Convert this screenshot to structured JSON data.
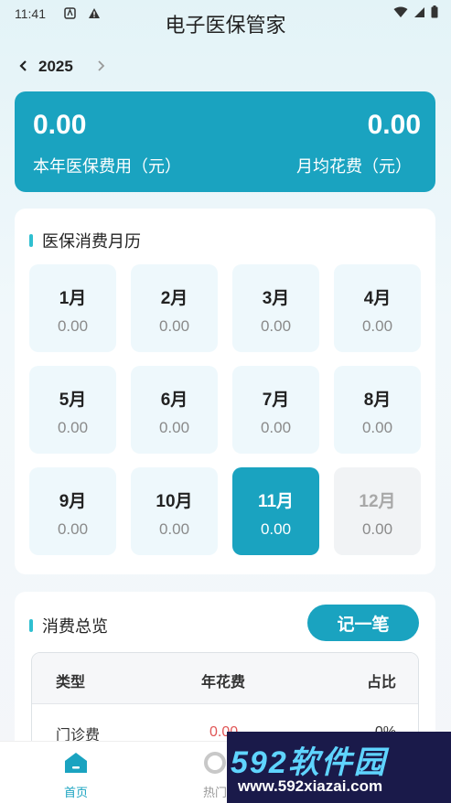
{
  "status": {
    "time": "11:41"
  },
  "header": {
    "title": "电子医保管家"
  },
  "year_nav": {
    "year": "2025",
    "prev": "‹",
    "next": "›"
  },
  "summary": {
    "annual_value": "0.00",
    "annual_label": "本年医保费用（元）",
    "monthly_value": "0.00",
    "monthly_label": "月均花费（元）"
  },
  "calendar": {
    "title": "医保消费月历",
    "months": [
      {
        "name": "1月",
        "amount": "0.00"
      },
      {
        "name": "2月",
        "amount": "0.00"
      },
      {
        "name": "3月",
        "amount": "0.00"
      },
      {
        "name": "4月",
        "amount": "0.00"
      },
      {
        "name": "5月",
        "amount": "0.00"
      },
      {
        "name": "6月",
        "amount": "0.00"
      },
      {
        "name": "7月",
        "amount": "0.00"
      },
      {
        "name": "8月",
        "amount": "0.00"
      },
      {
        "name": "9月",
        "amount": "0.00"
      },
      {
        "name": "10月",
        "amount": "0.00"
      },
      {
        "name": "11月",
        "amount": "0.00",
        "state": "selected"
      },
      {
        "name": "12月",
        "amount": "0.00",
        "state": "disabled"
      }
    ]
  },
  "overview": {
    "title": "消费总览",
    "record_button": "记一笔",
    "columns": {
      "type": "类型",
      "year": "年花费",
      "pct": "占比"
    },
    "rows": [
      {
        "type": "门诊费",
        "year": "0.00",
        "pct": "0%"
      }
    ]
  },
  "tabs": [
    {
      "label": "首页",
      "icon": "home-icon",
      "active": true
    },
    {
      "label": "热门",
      "icon": "hot-icon",
      "active": false
    }
  ],
  "watermark": {
    "brand": "592软件园",
    "url": "www.592xiazai.com"
  },
  "colors": {
    "accent": "#1aa3c0",
    "red": "#e05555"
  }
}
